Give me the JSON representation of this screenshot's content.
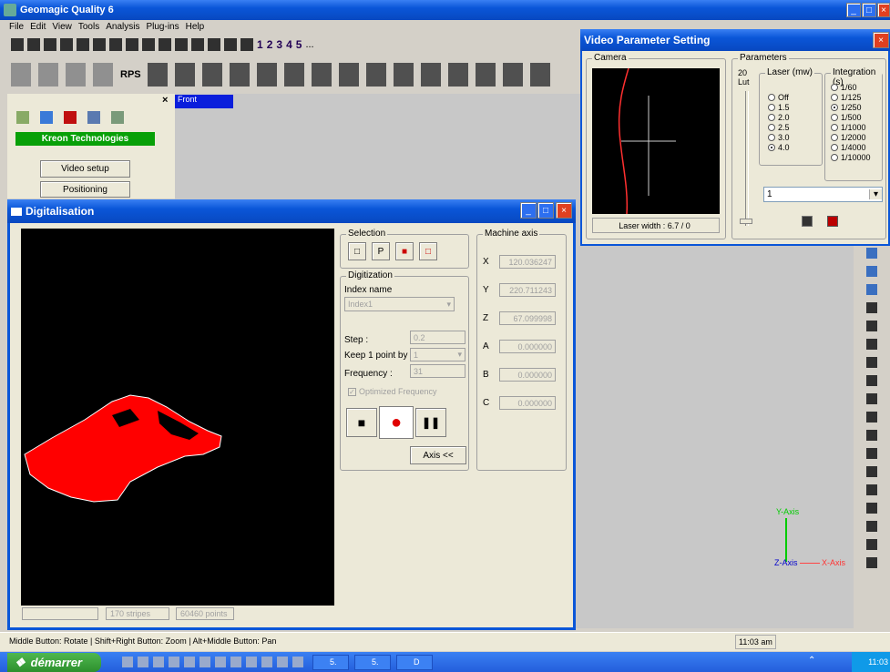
{
  "app": {
    "title": "Geomagic Quality 6"
  },
  "menu": [
    "File",
    "Edit",
    "View",
    "Tools",
    "Analysis",
    "Plug-ins",
    "Help"
  ],
  "toolbar": {
    "numbers": [
      "1",
      "2",
      "3",
      "4",
      "5"
    ],
    "more": "...",
    "rps": "RPS"
  },
  "left_panel": {
    "brand": "Kreon Technologies",
    "video_setup": "Video setup",
    "positioning": "Positioning",
    "close": "×"
  },
  "viewport": {
    "tab": "Front",
    "y_axis": "Y-Axis",
    "z_axis": "Z-Axis",
    "x_axis": "X-Axis"
  },
  "digitalisation": {
    "title": "Digitalisation",
    "selection_label": "Selection",
    "digitization_label": "Digitization",
    "index_name_label": "Index name",
    "index_value": "Index1",
    "step_label": "Step :",
    "step_value": "0.2",
    "keep_label": "Keep 1 point by :",
    "keep_value": "1",
    "frequency_label": "Frequency :",
    "frequency_value": "31",
    "optimized_label": "Optimized Frequency",
    "axis_button": "Axis <<",
    "machine_axis_label": "Machine axis",
    "axes": [
      {
        "name": "X",
        "value": "120.036247"
      },
      {
        "name": "Y",
        "value": "220.711243"
      },
      {
        "name": "Z",
        "value": "67.099998"
      },
      {
        "name": "A",
        "value": "0.000000"
      },
      {
        "name": "B",
        "value": "0.000000"
      },
      {
        "name": "C",
        "value": "0.000000"
      }
    ],
    "status": {
      "left": "",
      "stripes": "170 stripes",
      "points": "60460 points"
    }
  },
  "video_param": {
    "title": "Video Parameter Setting",
    "camera_label": "Camera",
    "parameters_label": "Parameters",
    "lut_top": "20",
    "lut_label": "Lut",
    "laser_label": "Laser (mw)",
    "laser_options": [
      "Off",
      "1.5",
      "2.0",
      "2.5",
      "3.0",
      "4.0"
    ],
    "laser_selected": 5,
    "integration_label": "Integration (s)",
    "integration_options": [
      "1/60",
      "1/125",
      "1/250",
      "1/500",
      "1/1000",
      "1/2000",
      "1/4000",
      "1/10000"
    ],
    "integration_selected": 2,
    "dropdown_value": "1",
    "laser_width": "Laser width : 6.7 / 0"
  },
  "statusbar": {
    "hint": "Middle Button: Rotate | Shift+Right Button: Zoom | Alt+Middle Button: Pan",
    "time": "11:03 am"
  },
  "taskbar": {
    "start": "démarrer",
    "tasks": [
      "5.",
      "5.",
      "D"
    ],
    "clock": "11:03"
  },
  "colors": {
    "xp_blue": "#0a56d8",
    "green": "#08a008",
    "scan_red": "#ff0000",
    "viewport": "#c8c8c8"
  }
}
